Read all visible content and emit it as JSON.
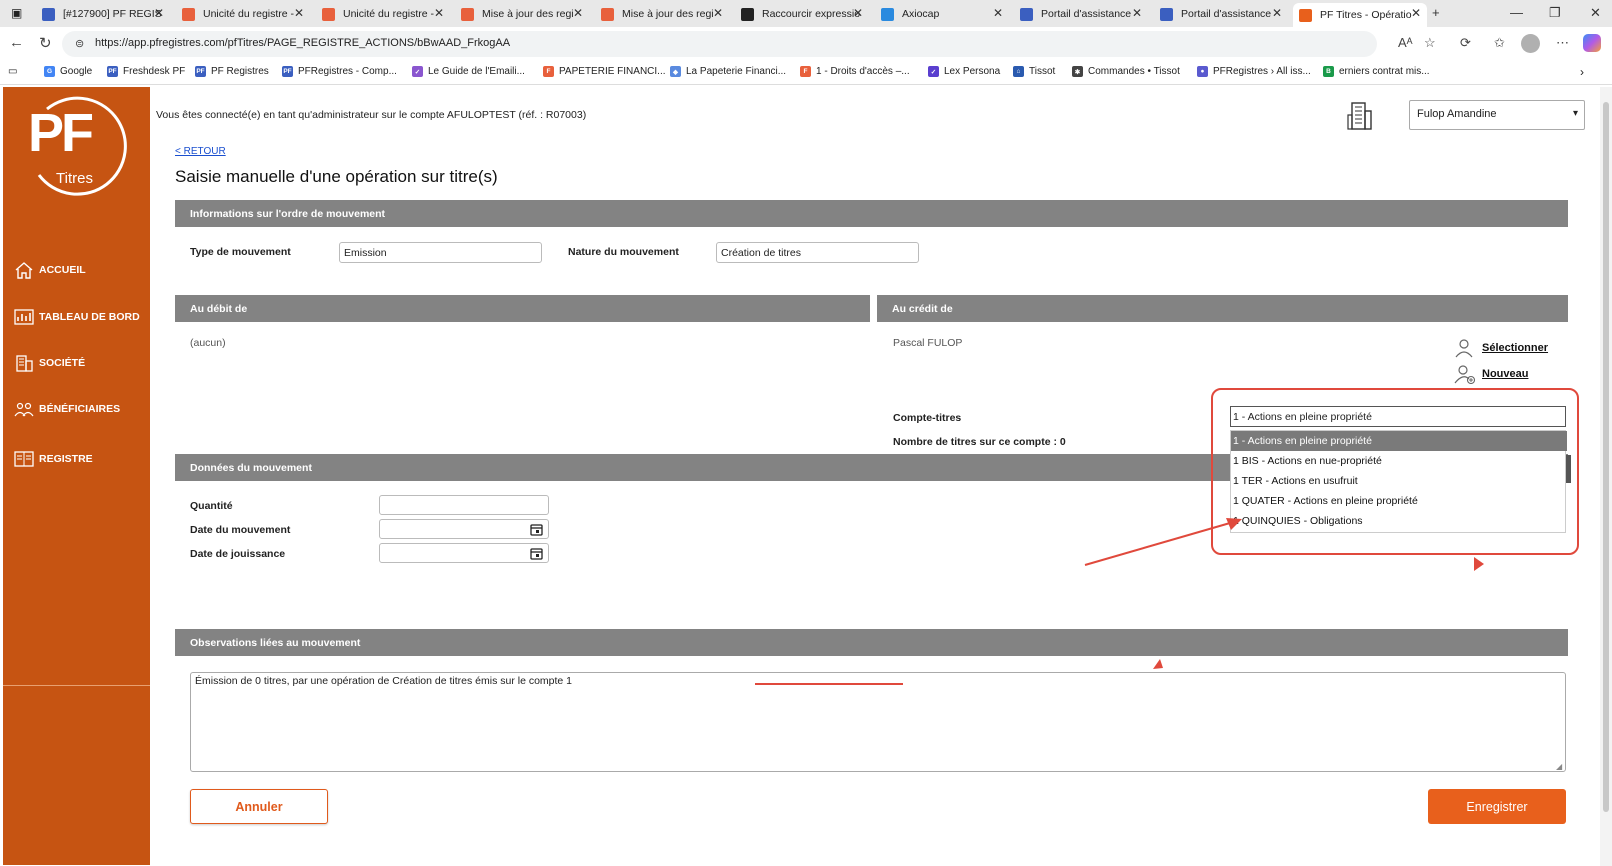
{
  "browser": {
    "tabs": [
      {
        "label": "[#127900] PF REGIS",
        "favicon": "pf-icon",
        "color": "#3b5fc0"
      },
      {
        "label": "Unicité du registre -",
        "favicon": "figma-icon",
        "color": "#e8603c"
      },
      {
        "label": "Unicité du registre -",
        "favicon": "figma-icon",
        "color": "#e8603c"
      },
      {
        "label": "Mise à jour des regi",
        "favicon": "figma-icon",
        "color": "#e8603c"
      },
      {
        "label": "Mise à jour des regi",
        "favicon": "figma-icon",
        "color": "#e8603c"
      },
      {
        "label": "Raccourcir expressio",
        "favicon": "chatgpt-icon",
        "color": "#222222"
      },
      {
        "label": "Axiocap",
        "favicon": "axiocap-icon",
        "color": "#2a8adf"
      },
      {
        "label": "Portail d'assistance",
        "favicon": "pf-icon",
        "color": "#3b5fc0"
      },
      {
        "label": "Portail d'assistance",
        "favicon": "pf-icon",
        "color": "#3b5fc0"
      },
      {
        "label": "PF Titres - Opératio",
        "favicon": "pf-orange-icon",
        "color": "#e8601c"
      }
    ],
    "url": "https://app.pfregistres.com/pfTitres/PAGE_REGISTRE_ACTIONS/bBwAAD_FrkogAA",
    "bookmarks": [
      {
        "label": "Google",
        "color": "#4285f4",
        "glyph": "G"
      },
      {
        "label": "Freshdesk PF",
        "color": "#3b5fc0",
        "glyph": "PF"
      },
      {
        "label": "PF Registres",
        "color": "#3b5fc0",
        "glyph": "PF"
      },
      {
        "label": "PFRegistres - Comp...",
        "color": "#3b5fc0",
        "glyph": "PF"
      },
      {
        "label": "Le Guide de l'Emaili...",
        "color": "#8a56cf",
        "glyph": "✓"
      },
      {
        "label": "PAPETERIE FINANCI...",
        "color": "#e8603c",
        "glyph": "F"
      },
      {
        "label": "La Papeterie Financi...",
        "color": "#5a8adf",
        "glyph": "◆"
      },
      {
        "label": "1 - Droits d'accès –...",
        "color": "#e8603c",
        "glyph": "F"
      },
      {
        "label": "Lex Persona",
        "color": "#5a3fcf",
        "glyph": "✓"
      },
      {
        "label": "Tissot",
        "color": "#2a5aaf",
        "glyph": "⌂"
      },
      {
        "label": "Commandes • Tissot",
        "color": "#444444",
        "glyph": "✱"
      },
      {
        "label": "PFRegistres › All iss...",
        "color": "#5a5acf",
        "glyph": "●"
      },
      {
        "label": "erniers contrat mis...",
        "color": "#1a9a4a",
        "glyph": "B"
      }
    ]
  },
  "sidebar": {
    "logo_text": "PF",
    "logo_subtext": "Titres",
    "items": [
      {
        "label": "ACCUEIL",
        "icon": "home-icon"
      },
      {
        "label": "TABLEAU DE BORD",
        "icon": "dashboard-icon"
      },
      {
        "label": "SOCIÉTÉ",
        "icon": "company-icon"
      },
      {
        "label": "BÉNÉFICIAIRES",
        "icon": "beneficiaries-icon"
      },
      {
        "label": "REGISTRE",
        "icon": "register-icon"
      }
    ]
  },
  "header": {
    "connected_text": "Vous êtes connecté(e) en tant qu'administrateur sur le compte AFULOPTEST (réf. : R07003)",
    "user_select": "Fulop Amandine"
  },
  "page": {
    "back_link": "< RETOUR",
    "title": "Saisie manuelle d'une opération sur titre(s)"
  },
  "sections": {
    "ordre": {
      "title": "Informations sur l'ordre de mouvement",
      "type_label": "Type de mouvement",
      "type_value": "Emission",
      "nature_label": "Nature du mouvement",
      "nature_value": "Création de titres"
    },
    "debit": {
      "title": "Au débit de",
      "value": "(aucun)"
    },
    "credit": {
      "title": "Au crédit de",
      "holder": "Pascal FULOP",
      "select_link": "Sélectionner",
      "new_link": "Nouveau",
      "account_label": "Compte-titres",
      "account_value": "1 - Actions en pleine propriété",
      "count_label": "Nombre de titres sur ce compte : 0",
      "options": [
        "1 - Actions en pleine propriété",
        "1 BIS - Actions en nue-propriété",
        "1 TER - Actions en usufruit",
        "1 QUATER - Actions en pleine propriété",
        "1 QUINQUIES - Obligations"
      ],
      "selected_index": 0
    },
    "donnees": {
      "title": "Données du mouvement",
      "quantity_label": "Quantité",
      "quantity_value": "",
      "date_label": "Date du mouvement",
      "date_value": "",
      "jouissance_label": "Date de jouissance",
      "jouissance_value": ""
    },
    "observations": {
      "title": "Observations liées au mouvement",
      "text": "Émission de 0 titres, par une opération de Création de titres émis sur le compte 1"
    }
  },
  "actions": {
    "cancel": "Annuler",
    "save": "Enregistrer"
  },
  "colors": {
    "brand_orange": "#c65412",
    "button_orange": "#e8601c",
    "section_gray": "#838383",
    "annotation_red": "#e0493c"
  }
}
